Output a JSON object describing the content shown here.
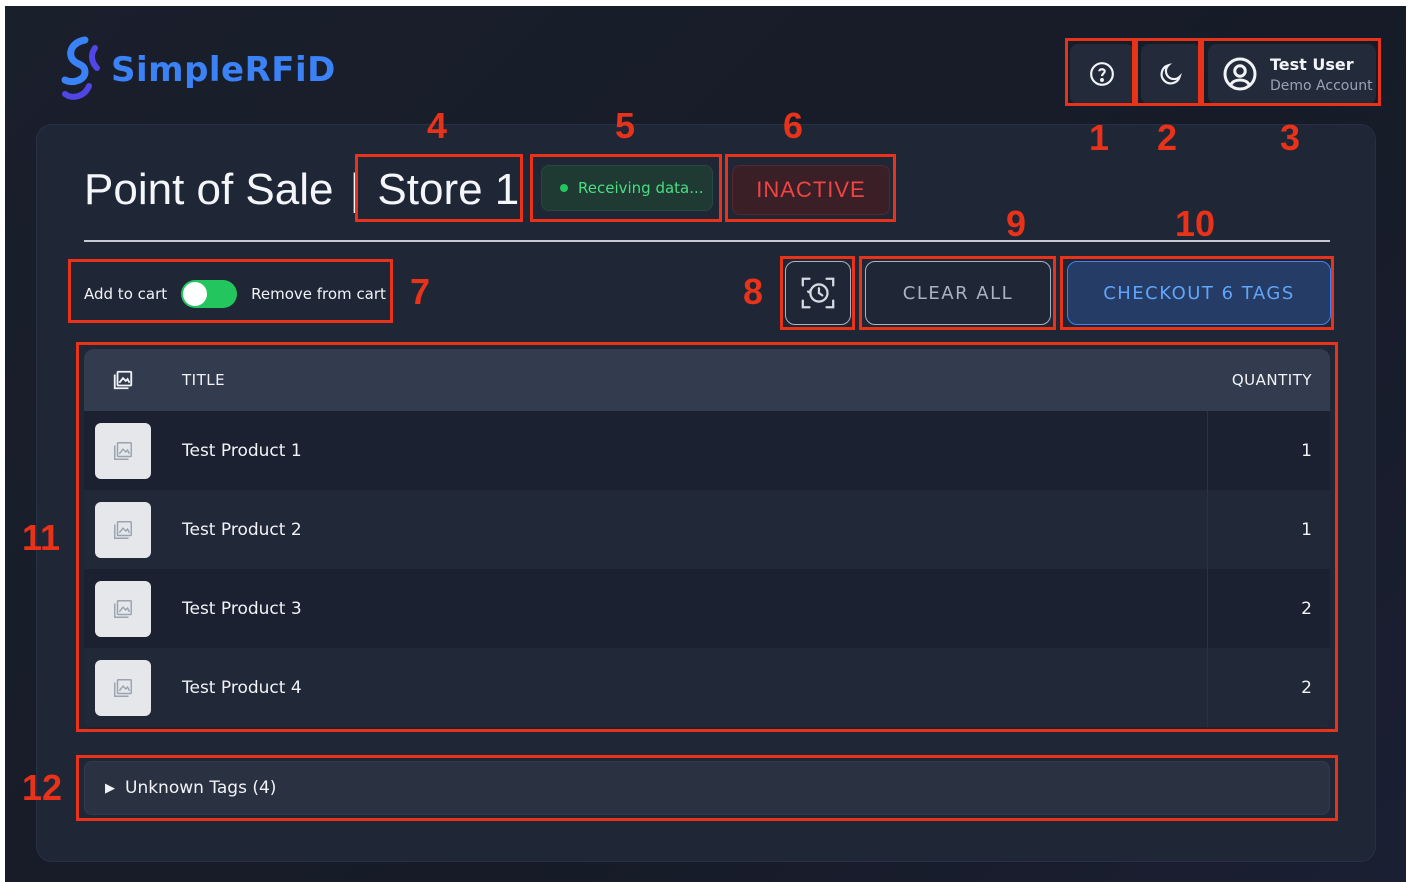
{
  "header": {
    "logo_text": "SimpleRFiD",
    "help_icon": "help-circle-icon",
    "theme_icon": "moon-icon",
    "user": {
      "name": "Test User",
      "subtitle": "Demo Account",
      "icon": "user-circle-icon"
    }
  },
  "page": {
    "title_prefix": "Point of Sale",
    "title_separator": "|",
    "store_name": "Store 1",
    "status_text": "Receiving data...",
    "state_badge": "INACTIVE"
  },
  "controls": {
    "toggle_left_label": "Add to cart",
    "toggle_right_label": "Remove from cart",
    "history_icon": "scan-history-icon",
    "clear_label": "CLEAR ALL",
    "checkout_label": "CHECKOUT 6 TAGS"
  },
  "table": {
    "columns": {
      "image_icon": "image-gallery-icon",
      "title": "TITLE",
      "quantity": "QUANTITY"
    },
    "rows": [
      {
        "title": "Test Product 1",
        "quantity": "1"
      },
      {
        "title": "Test Product 2",
        "quantity": "1"
      },
      {
        "title": "Test Product 3",
        "quantity": "2"
      },
      {
        "title": "Test Product 4",
        "quantity": "2"
      }
    ]
  },
  "unknown_tags": {
    "label": "Unknown Tags (4)"
  },
  "annotations": [
    "1",
    "2",
    "3",
    "4",
    "5",
    "6",
    "7",
    "8",
    "9",
    "10",
    "11",
    "12"
  ],
  "colors": {
    "accent": "#3b82f6",
    "annotation": "#e8321a",
    "status_green": "#4ade80",
    "inactive_red": "#ef4444"
  }
}
